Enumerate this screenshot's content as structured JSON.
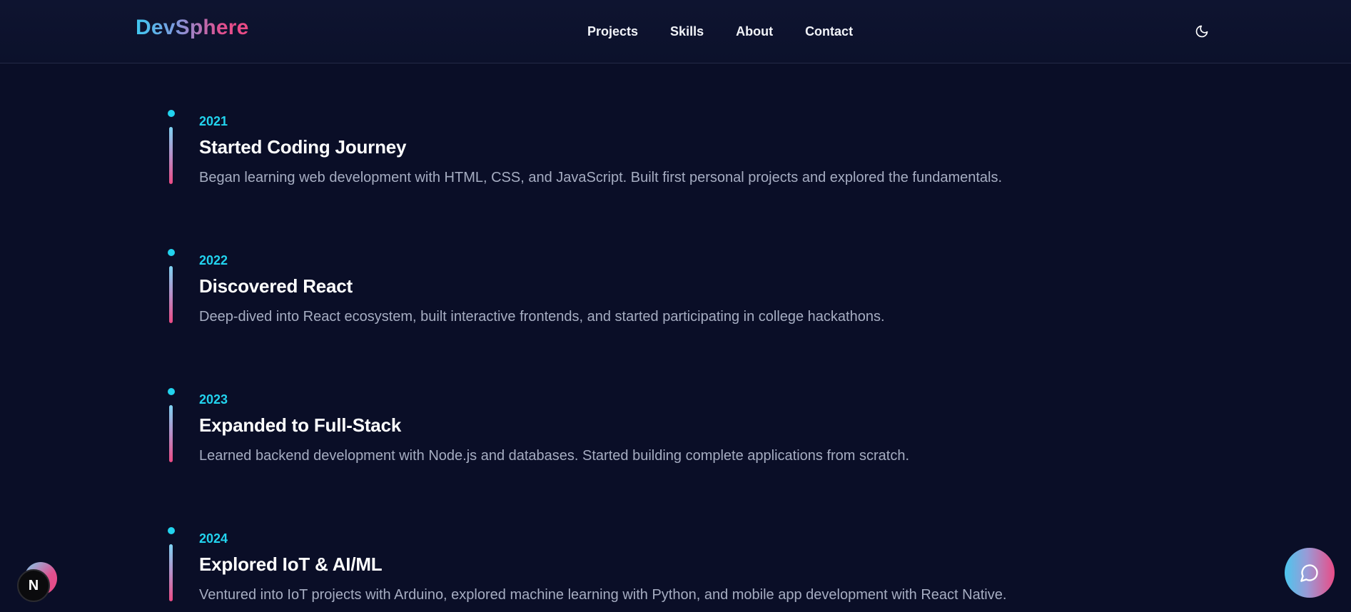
{
  "brand": {
    "name": "DevSphere"
  },
  "nav": {
    "items": [
      {
        "label": "Projects"
      },
      {
        "label": "Skills"
      },
      {
        "label": "About"
      },
      {
        "label": "Contact"
      }
    ]
  },
  "header": {
    "theme_icon": "moon-icon"
  },
  "timeline": [
    {
      "year": "2021",
      "title": "Started Coding Journey",
      "description": "Began learning web development with HTML, CSS, and JavaScript. Built first personal projects and explored the fundamentals."
    },
    {
      "year": "2022",
      "title": "Discovered React",
      "description": "Deep-dived into React ecosystem, built interactive frontends, and started participating in college hackathons."
    },
    {
      "year": "2023",
      "title": "Expanded to Full-Stack",
      "description": "Learned backend development with Node.js and databases. Started building complete applications from scratch."
    },
    {
      "year": "2024",
      "title": "Explored IoT & AI/ML",
      "description": "Ventured into IoT projects with Arduino, explored machine learning with Python, and mobile app development with React Native."
    }
  ],
  "floating": {
    "next_badge_letter": "N",
    "chat_icon": "chat-bubble-icon"
  },
  "colors": {
    "background": "#0a0e27",
    "accent_cyan": "#22d3ee",
    "accent_pink": "#ec4a84",
    "text_muted": "#a6adc2"
  }
}
